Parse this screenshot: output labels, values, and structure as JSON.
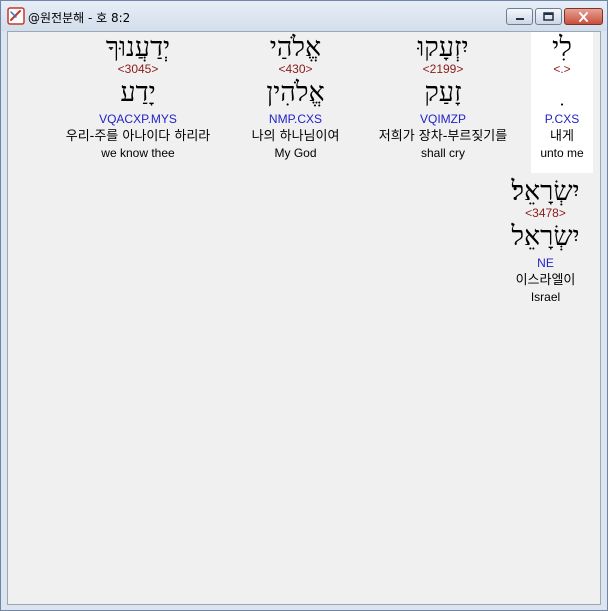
{
  "window": {
    "title": "@원전분해 - 호 8:2",
    "min_glyph": "–",
    "max_glyph": "□",
    "close_glyph": "✕"
  },
  "words": [
    {
      "hebrew": "לִי",
      "strong": "<.>",
      "lemma": "ִ",
      "parse": "P.CXS",
      "korean": "내게",
      "english": "unto me"
    },
    {
      "hebrew": "יִזְעָקוּ",
      "strong": "<2199>",
      "lemma": "זָעַק",
      "parse": "VQIMZP",
      "korean": "저희가 장차-부르짖기를",
      "english": "shall cry"
    },
    {
      "hebrew": "אֱלֹהַי",
      "strong": "<430>",
      "lemma": "אֱלֹהִין",
      "parse": "NMP.CXS",
      "korean": "나의 하나님이여",
      "english": "My God"
    },
    {
      "hebrew": "יְדַעֲנוּךָ",
      "strong": "<3045>",
      "lemma": "יָדַע",
      "parse": "VQACXP.MYS",
      "korean": "우리-주를 아나이다 하리라",
      "english": "we know thee"
    },
    {
      "hebrew": "יִשְׂרָאֵל׃",
      "strong": "<3478>",
      "lemma": "יִשְׂרָאֵל",
      "parse": "NE",
      "korean": "이스라엘이",
      "english": "Israel"
    }
  ]
}
